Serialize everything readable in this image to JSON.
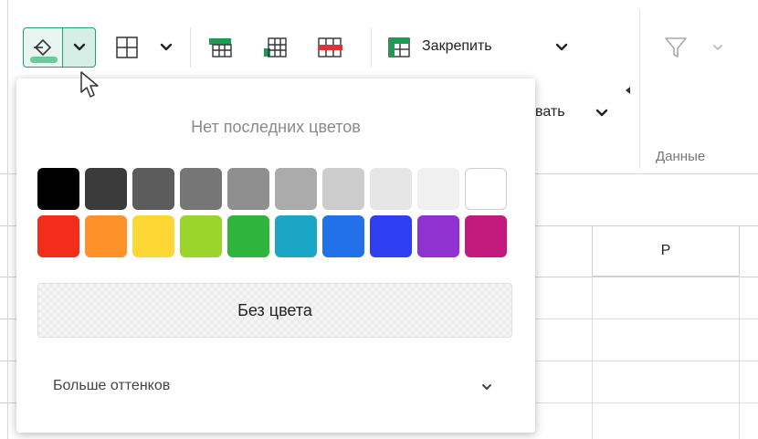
{
  "toolbar": {
    "freeze_label": "Закрепить",
    "partial_label": "вать",
    "data_group_label": "Данные"
  },
  "sheet": {
    "column_header": "P"
  },
  "color_popup": {
    "recent_title": "Нет последних цветов",
    "no_color_label": "Без цвета",
    "more_shades_label": "Больше оттенков",
    "swatch_rows": [
      [
        "#000000",
        "#3b3b3b",
        "#5c5c5c",
        "#767676",
        "#8f8f8f",
        "#ababab",
        "#cccccc",
        "#e6e6e6",
        "#f0f0f0",
        "#ffffff"
      ],
      [
        "#f22d1b",
        "#ff912b",
        "#fdd835",
        "#9ad42c",
        "#2fb43c",
        "#1aa6c4",
        "#2271e8",
        "#2d3ff0",
        "#8f32d1",
        "#c41a7e"
      ]
    ]
  },
  "colors": {
    "accent": "#20a080",
    "fill_color_bar": "#6cc99a"
  }
}
